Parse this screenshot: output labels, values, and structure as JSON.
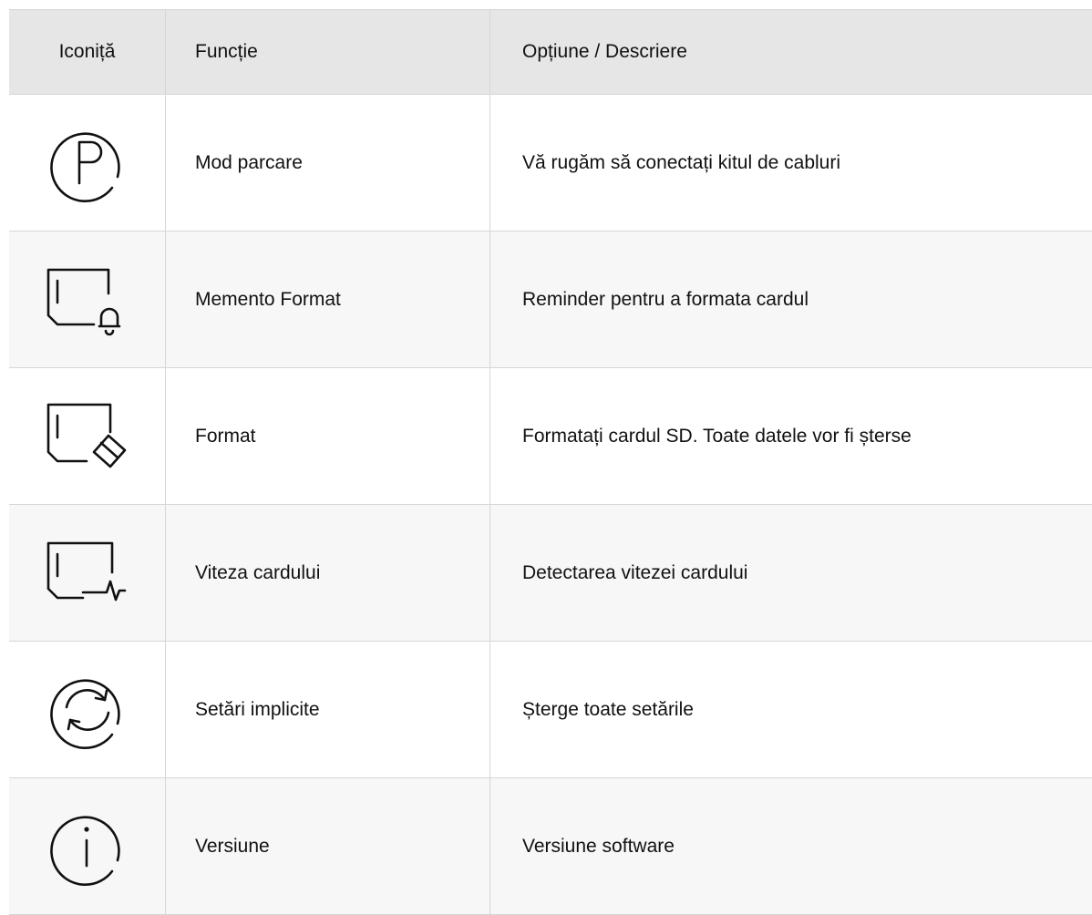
{
  "header": {
    "col_icon": "Iconiță",
    "col_function": "Funcție",
    "col_description": "Opțiune / Descriere"
  },
  "rows": [
    {
      "icon": "parking-icon",
      "function": "Mod parcare",
      "description": "Vă rugăm să conectați kitul de cabluri"
    },
    {
      "icon": "sd-card-bell-icon",
      "function": "Memento Format",
      "description": "Reminder pentru a formata cardul"
    },
    {
      "icon": "sd-card-eraser-icon",
      "function": "Format",
      "description": "Formatați cardul SD. Toate datele vor fi șterse"
    },
    {
      "icon": "sd-card-pulse-icon",
      "function": "Viteza cardului",
      "description": "Detectarea vitezei cardului"
    },
    {
      "icon": "reset-icon",
      "function": "Setări implicite",
      "description": "Șterge toate setările"
    },
    {
      "icon": "info-icon",
      "function": "Versiune",
      "description": "Versiune software"
    }
  ]
}
